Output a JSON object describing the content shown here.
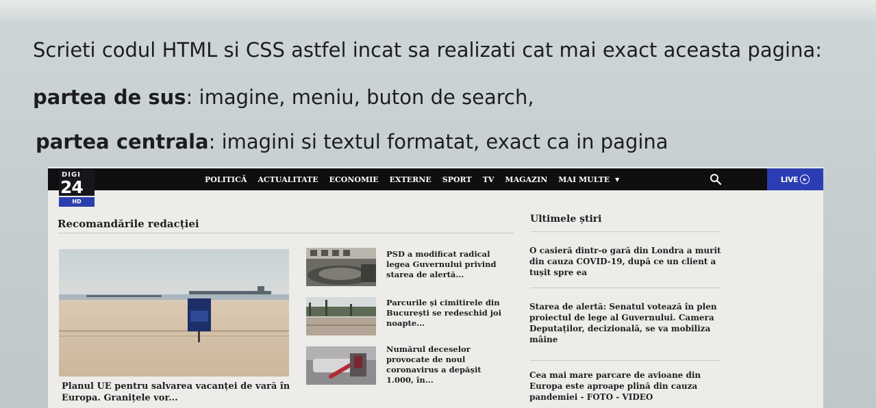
{
  "instructions": {
    "line1": "Scrieti codul HTML si CSS astfel incat sa realizati cat mai exact aceasta pagina:",
    "line2_bold": "partea de sus",
    "line2_rest": ": imagine, meniu,  buton de search,",
    "line3_bold": "partea centrala",
    "line3_rest": ": imagini si textul formatat, exact ca in pagina"
  },
  "logo": {
    "top": "DIGI",
    "number": "24",
    "hd": "HD"
  },
  "nav": {
    "items": [
      "POLITICĂ",
      "ACTUALITATE",
      "ECONOMIE",
      "EXTERNE",
      "SPORT",
      "TV",
      "MAGAZIN"
    ],
    "more": "MAI MULTE",
    "more_icon": "caret-down-icon",
    "search_icon": "search-icon",
    "live": "LIVE"
  },
  "recommended": {
    "title": "Recomandările redacției",
    "main_caption": "Planul UE pentru salvarea vacanței de vară în Europa. Granițele vor...",
    "main_sign": "BEACHES CLOSED",
    "items": [
      "PSD a modificat radical legea Guvernului privind starea de alertă...",
      "Parcurile și cimitirele din București se redeschid joi noapte...",
      "Numărul deceselor provocate de noul coronavirus a depășit 1.000, în..."
    ]
  },
  "latest": {
    "title": "Ultimele știri",
    "items": [
      "O casieră dintr-o gară din Londra a murit din cauza COVID-19, după ce un client a tușit spre ea",
      "Starea de alertă: Senatul votează în plen proiectul de lege al Guvernului. Camera Deputaților, decizională, se va mobiliza mâine",
      "Cea mai mare parcare de avioane din Europa este aproape plină din cauza pandemiei - FOTO - VIDEO"
    ]
  },
  "colors": {
    "topbar": "#0f0f12",
    "live_bg": "#2c3db3",
    "hd_bg": "#2b3fae",
    "page_bg": "#edece8"
  }
}
